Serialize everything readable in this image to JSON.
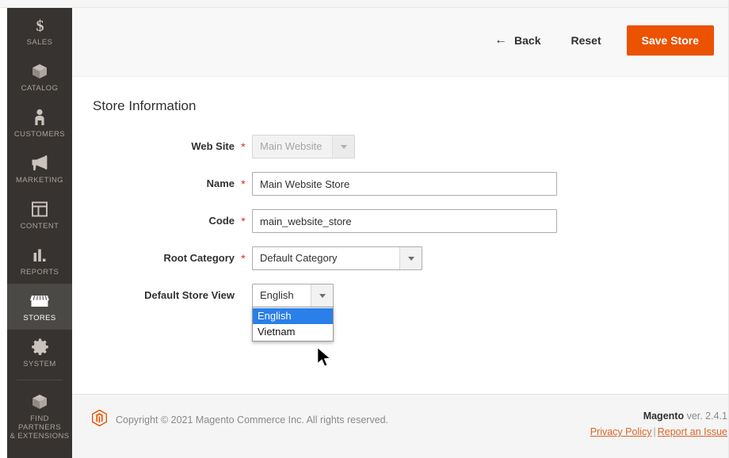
{
  "sidebar": {
    "items": [
      {
        "label": "SALES",
        "icon": "dollar-icon",
        "active": false
      },
      {
        "label": "CATALOG",
        "icon": "box-icon",
        "active": false
      },
      {
        "label": "CUSTOMERS",
        "icon": "person-icon",
        "active": false
      },
      {
        "label": "MARKETING",
        "icon": "megaphone-icon",
        "active": false
      },
      {
        "label": "CONTENT",
        "icon": "layout-icon",
        "active": false
      },
      {
        "label": "REPORTS",
        "icon": "bar-chart-icon",
        "active": false
      },
      {
        "label": "STORES",
        "icon": "storefront-icon",
        "active": true
      },
      {
        "label": "SYSTEM",
        "icon": "gear-icon",
        "active": false
      },
      {
        "label": "FIND PARTNERS\n& EXTENSIONS",
        "icon": "extension-icon",
        "active": false
      }
    ],
    "find_partners_line1": "FIND PARTNERS",
    "find_partners_line2": "& EXTENSIONS"
  },
  "page_actions": {
    "back_label": "Back",
    "back_icon": "arrow-left-icon",
    "reset_label": "Reset",
    "save_label": "Save Store",
    "save_color": "#eb5202"
  },
  "content": {
    "section_title": "Store Information",
    "required_marker": "*",
    "fields": {
      "website": {
        "label": "Web Site",
        "required": true,
        "value": "Main Website",
        "disabled": true
      },
      "name": {
        "label": "Name",
        "required": true,
        "value": "Main Website Store",
        "placeholder": ""
      },
      "code": {
        "label": "Code",
        "required": true,
        "value": "main_website_store",
        "placeholder": ""
      },
      "root_category": {
        "label": "Root Category",
        "required": true,
        "value": "Default Category",
        "disabled": false
      },
      "default_store_view": {
        "label": "Default Store View",
        "required": false,
        "value": "English",
        "open": true,
        "options": [
          {
            "label": "English",
            "selected": true
          },
          {
            "label": "Vietnam",
            "selected": false
          }
        ],
        "highlight_color": "#2a7fe8"
      }
    }
  },
  "footer": {
    "logo_icon": "magento-logo-icon",
    "copyright": "Copyright © 2021 Magento Commerce Inc. All rights reserved.",
    "brand": "Magento",
    "version": "ver. 2.4.1",
    "privacy_label": "Privacy Policy",
    "separator": "|",
    "report_label": "Report an Issue",
    "link_color": "#d9642a"
  },
  "cursor": {
    "icon": "mouse-pointer-icon"
  }
}
